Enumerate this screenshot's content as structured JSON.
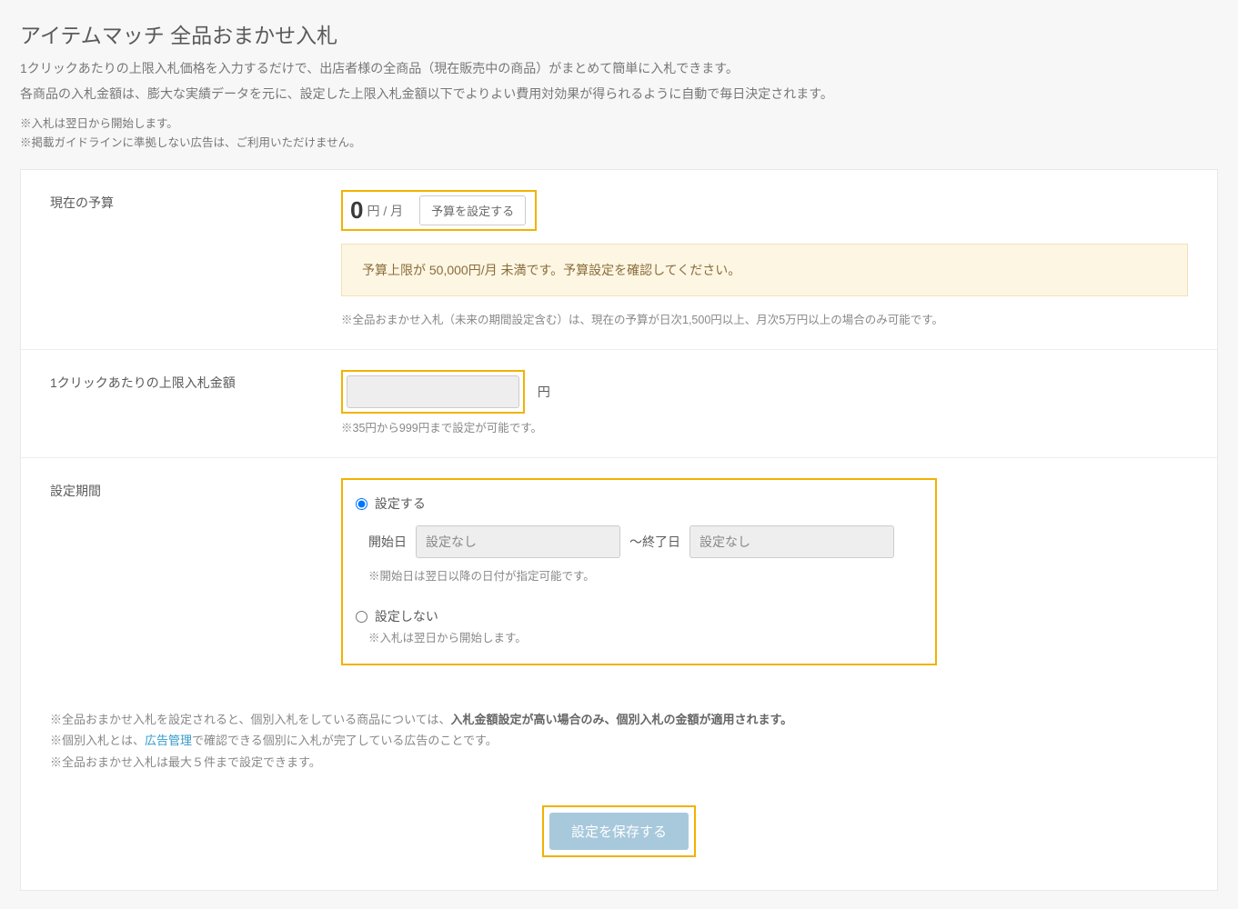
{
  "header": {
    "title": "アイテムマッチ 全品おまかせ入札",
    "intro1": "1クリックあたりの上限入札価格を入力するだけで、出店者様の全商品（現在販売中の商品）がまとめて簡単に入札できます。",
    "intro2": "各商品の入札金額は、膨大な実績データを元に、設定した上限入札金額以下でよりよい費用対効果が得られるように自動で毎日決定されます。",
    "note1": "※入札は翌日から開始します。",
    "note2": "※掲載ガイドラインに準拠しない広告は、ご利用いただけません。"
  },
  "budget": {
    "label": "現在の予算",
    "value": "0",
    "unit": "円 / 月",
    "button": "予算を設定する",
    "warning": "予算上限が 50,000円/月 未満です。予算設定を確認してください。",
    "note": "※全品おまかせ入札（未来の期間設定含む）は、現在の予算が日次1,500円以上、月次5万円以上の場合のみ可能です。"
  },
  "bid": {
    "label": "1クリックあたりの上限入札金額",
    "unit": "円",
    "note": "※35円から999円まで設定が可能です。"
  },
  "period": {
    "label": "設定期間",
    "option_set": "設定する",
    "start_label": "開始日",
    "start_placeholder": "設定なし",
    "end_sep": "～終了日",
    "end_placeholder": "設定なし",
    "start_note": "※開始日は翌日以降の日付が指定可能です。",
    "option_none": "設定しない",
    "none_note": "※入札は翌日から開始します。"
  },
  "footer": {
    "note1a": "※全品おまかせ入札を設定されると、個別入札をしている商品については、",
    "note1b": "入札金額設定が高い場合のみ、個別入札の金額が適用されます。",
    "note2a": "※個別入札とは、",
    "note2_link": "広告管理",
    "note2b": "で確認できる個別に入札が完了している広告のことです。",
    "note3": "※全品おまかせ入札は最大５件まで設定できます。"
  },
  "save_button": "設定を保存する"
}
